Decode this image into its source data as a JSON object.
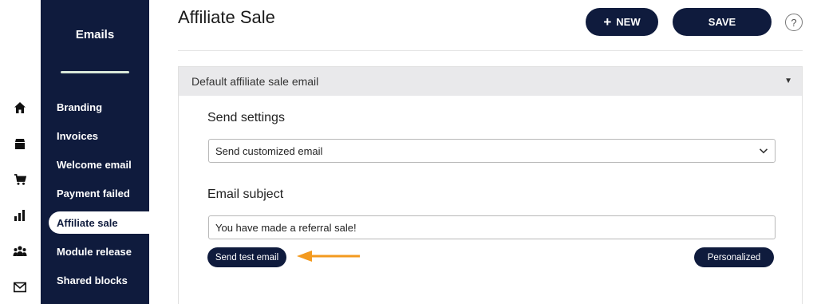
{
  "rail": {
    "icons": [
      "home-icon",
      "store-icon",
      "cart-icon",
      "chart-icon",
      "users-icon",
      "mail-icon"
    ]
  },
  "sidebar": {
    "title": "Emails",
    "items": [
      {
        "label": "Branding"
      },
      {
        "label": "Invoices"
      },
      {
        "label": "Welcome email"
      },
      {
        "label": "Payment failed"
      },
      {
        "label": "Affiliate sale"
      },
      {
        "label": "Module release"
      },
      {
        "label": "Shared blocks"
      }
    ],
    "active_index": 4
  },
  "header": {
    "title": "Affiliate Sale",
    "new_label": "NEW",
    "save_label": "SAVE",
    "help_label": "?"
  },
  "panel": {
    "title": "Default affiliate sale email",
    "send_settings_label": "Send settings",
    "send_settings_value": "Send customized email",
    "email_subject_label": "Email subject",
    "email_subject_value": "You have made a referral sale!",
    "send_test_label": "Send test email",
    "personalized_label": "Personalized"
  },
  "colors": {
    "navy": "#0f1b3d",
    "arrow": "#f39a1f"
  }
}
